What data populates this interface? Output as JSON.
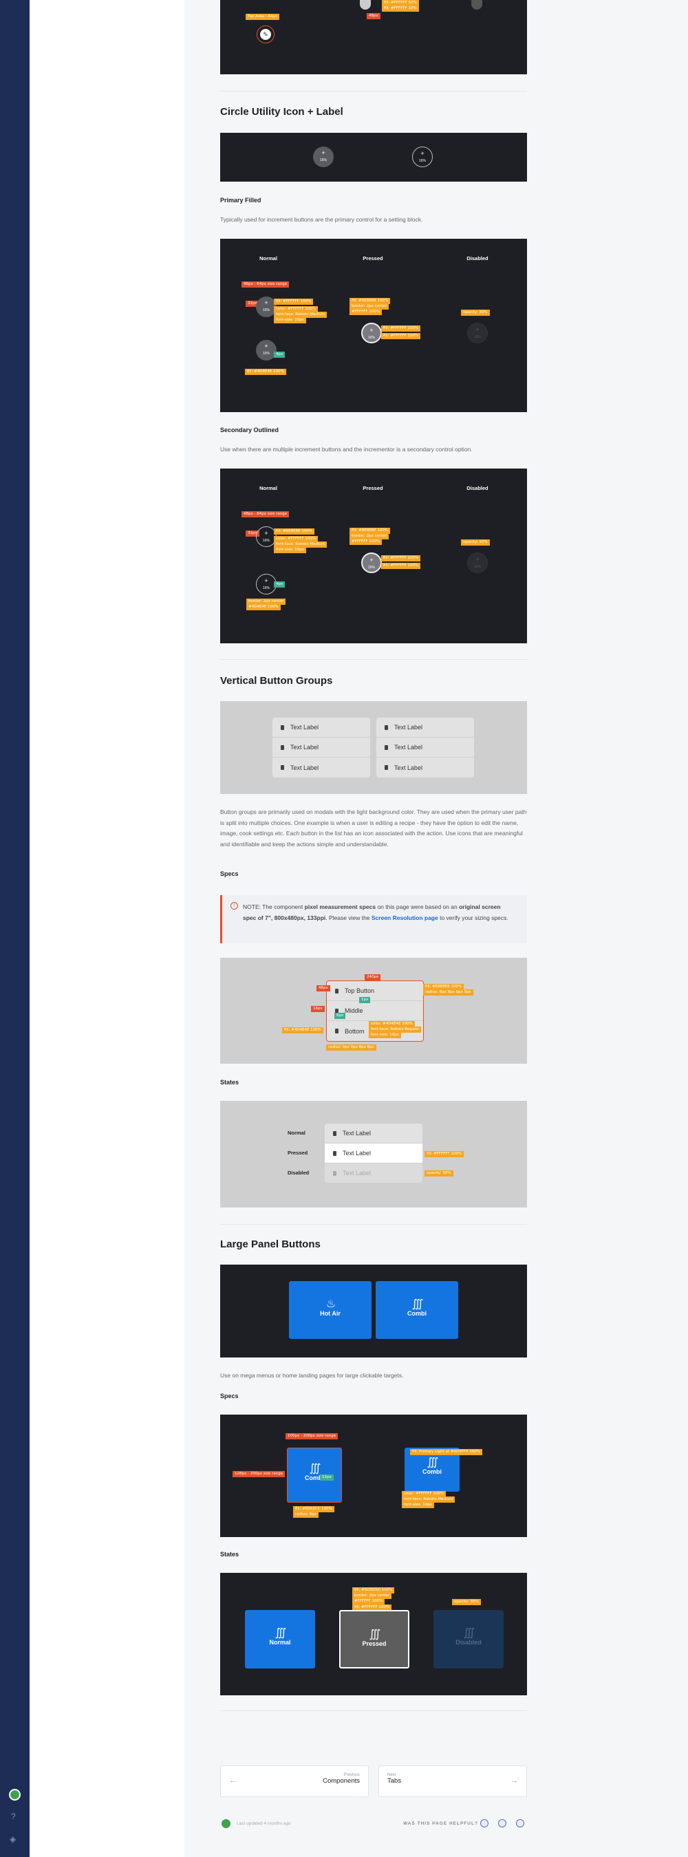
{
  "sections": {
    "circle_title": "Circle Utility Icon + Label",
    "vbg_title": "Vertical Button Groups",
    "lpb_title": "Large Panel Buttons"
  },
  "top_demo": {
    "tag_tap": "Tap Area - 44px",
    "tag_48": "48px",
    "tag_fill": "fill: #FFFFFF 10%",
    "tag_fill2": "fill: #FFFFFF 50%"
  },
  "circle": {
    "label": "16%",
    "primary_title": "Primary Filled",
    "primary_desc": "Typically used for increment buttons are the primary control for a setting block.",
    "secondary_title": "Secondary Outlined",
    "secondary_desc": "Use when there are multiple increment buttons and the incrementor is a secondary control option."
  },
  "states": {
    "normal": "Normal",
    "pressed": "Pressed",
    "disabled": "Disabled"
  },
  "primary_tags": {
    "range": "48px - 64px size range",
    "p32": "32px",
    "fill1": "fill: #FFFFFF 100%",
    "color1": "color: #FFFFFF 100%",
    "font1": "font-face: Roboto Medium",
    "fsize1": "font-size: 10px",
    "g4": "4px",
    "fillb": "fill: #4D4E4E 100%",
    "pfill": "fill: #666666 100%",
    "pborder": "border: 2px center",
    "pborder2": "#FFFFFF 100%",
    "pfillw": "fill: #FFFFFF 100%",
    "pfillw2": "fill: #FFFFFF 100%",
    "opacity": "opacity: 30%"
  },
  "secondary_tags": {
    "range": "48px - 64px size range",
    "p32": "32px",
    "fill1": "fill: #8E8E8E 100%",
    "color1": "color: #FFFFFF 100%",
    "font1": "font-face: Roboto Medium",
    "fsize1": "font-size: 10px",
    "g4": "4px",
    "border": "border: 2px center",
    "border2": "#4D4E4E 100%",
    "pfill": "fill: #8E8E8E 100%",
    "pborder": "border: 2px center",
    "pborder2": "#FFFFFF 100%",
    "pfillw": "fill: #FFFFFF 100%",
    "pfillw2": "fill: #FFFFFF 100%",
    "opacity": "opacity: 30%"
  },
  "vbg": {
    "btn": "Text Label",
    "desc": "Button groups are primarily used on modals with the light background color. They are used when the primary user path is split into multiple choices. One example is when a user is editing a recipe - they have the option to edit the name, image, cook settings etc. Each button in the list has an icon associated with the action. Use icons that are meaningful and identifiable and keep the actions simple and understandable.",
    "specs": "Specs",
    "note_pre": "NOTE: The component ",
    "note_b1": "pixel measurement specs",
    "note_mid": " on this page were based on an ",
    "note_b2": "original screen spec of 7\", 800x480px, 133ppi",
    "note_mid2": ". Please view the ",
    "note_link": "Screen Resolution page",
    "note_post": " to verify your sizing specs.",
    "top": "Top Button",
    "mid": "Middle",
    "bot": "Bottom",
    "t240": "240px",
    "t48": "48px",
    "t1px": "1px",
    "t16": "16px",
    "t8": "8px",
    "fill1": "fill: #E8E8E8 100%",
    "radius1": "radius: 8px 8px 0px 0px",
    "fill2": "fill: #4D4E4E 100%",
    "color1": "color: #4D4E4E 100%",
    "font1": "font-face: Roboto Regular",
    "fsize1": "font-size: 16px",
    "radius2": "radius: 0px 0px 8px 8px",
    "states": "States",
    "s_fill": "fill: #FFFFFF 100%",
    "s_opacity": "opacity: 30%"
  },
  "lpb": {
    "hot": "Hot Air",
    "combi": "Combi",
    "desc": "Use on mega menus or home landing pages for large clickable targets.",
    "specs": "Specs",
    "states": "States",
    "range1": "100px - 200px size range",
    "range2": "128px - 200px size range",
    "p32": "32px",
    "p12": "12px",
    "fill": "fill: #0062CC 100%",
    "radius": "radius: 8px",
    "fill2": "fill: Primary Light at #4D9FF4 100%",
    "color": "color: #FFFFFF 100%",
    "font": "font-face: Roboto Medium",
    "fsize": "font-size: 14px",
    "s_fill": "fill: #5D5D5D 100%",
    "s_border": "border: 2px center",
    "s_border2": "#FFFFFF 100%",
    "s_fill2": "fill: #FFFFFF 100%",
    "s_opacity": "opacity: 30%",
    "normal": "Normal",
    "pressed": "Pressed",
    "disabled": "Disabled"
  },
  "nav": {
    "prev_small": "Previous",
    "prev": "Components",
    "next_small": "Next",
    "next": "Tabs"
  },
  "footer": {
    "updated": "Last updated 4 months ago",
    "helpful": "WAS THIS PAGE HELPFUL?"
  }
}
